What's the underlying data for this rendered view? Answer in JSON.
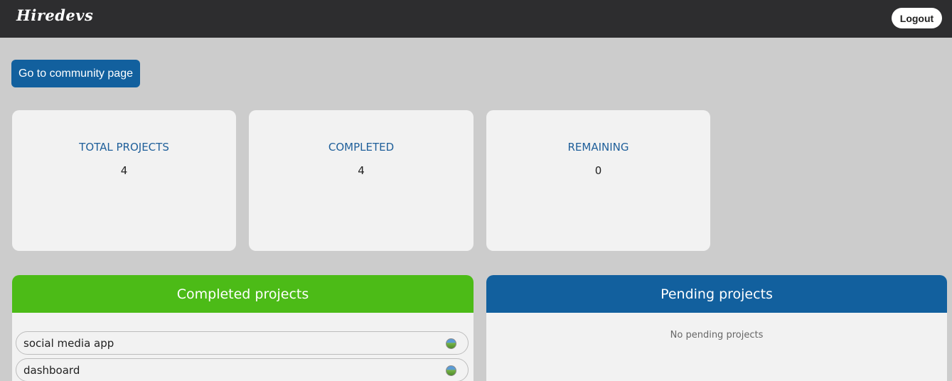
{
  "header": {
    "logo_text": "Hiredevs",
    "logout_label": "Logout"
  },
  "community_button_label": "Go to community page",
  "stats": [
    {
      "label": "TOTAL PROJECTS",
      "value": "4"
    },
    {
      "label": "COMPLETED",
      "value": "4"
    },
    {
      "label": "REMAINING",
      "value": "0"
    }
  ],
  "completed_panel": {
    "title": "Completed projects",
    "items": [
      {
        "name": "social media app",
        "icon": "avatar-icon"
      },
      {
        "name": "dashboard",
        "icon": "avatar-icon"
      }
    ]
  },
  "pending_panel": {
    "title": "Pending projects",
    "empty_message": "No pending projects"
  },
  "colors": {
    "topbar": "#2d2d2f",
    "primary_blue": "#12609e",
    "completed_green": "#4cbb17",
    "page_bg": "#cccccc",
    "card_bg": "#f2f2f2"
  }
}
